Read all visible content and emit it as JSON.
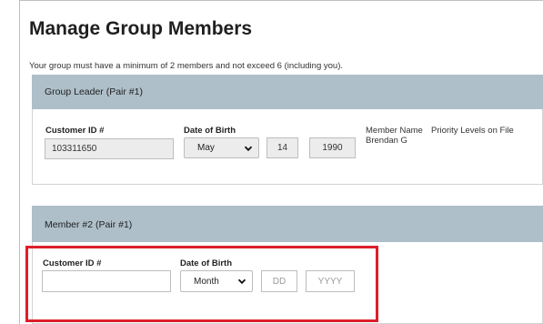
{
  "page": {
    "title": "Manage Group Members",
    "note": "Your group must have a minimum of 2 members and not exceed 6 (including you)."
  },
  "leader": {
    "header": "Group Leader (Pair #1)",
    "customer_id_label": "Customer ID #",
    "customer_id_value": "103311650",
    "dob_label": "Date of Birth",
    "month": "May",
    "day": "14",
    "year": "1990",
    "member_name_label": "Member Name",
    "member_name_value": "Brendan G",
    "priority_label": "Priority Levels on File"
  },
  "member2": {
    "header": "Member #2 (Pair #1)",
    "customer_id_label": "Customer ID #",
    "customer_id_value": "",
    "dob_label": "Date of Birth",
    "month": "Month",
    "day_placeholder": "DD",
    "year_placeholder": "YYYY"
  },
  "colors": {
    "section_header": "#aebfc9",
    "highlight": "#dc1f2b"
  },
  "icons": {
    "dropdown": "chevron-down-icon"
  }
}
